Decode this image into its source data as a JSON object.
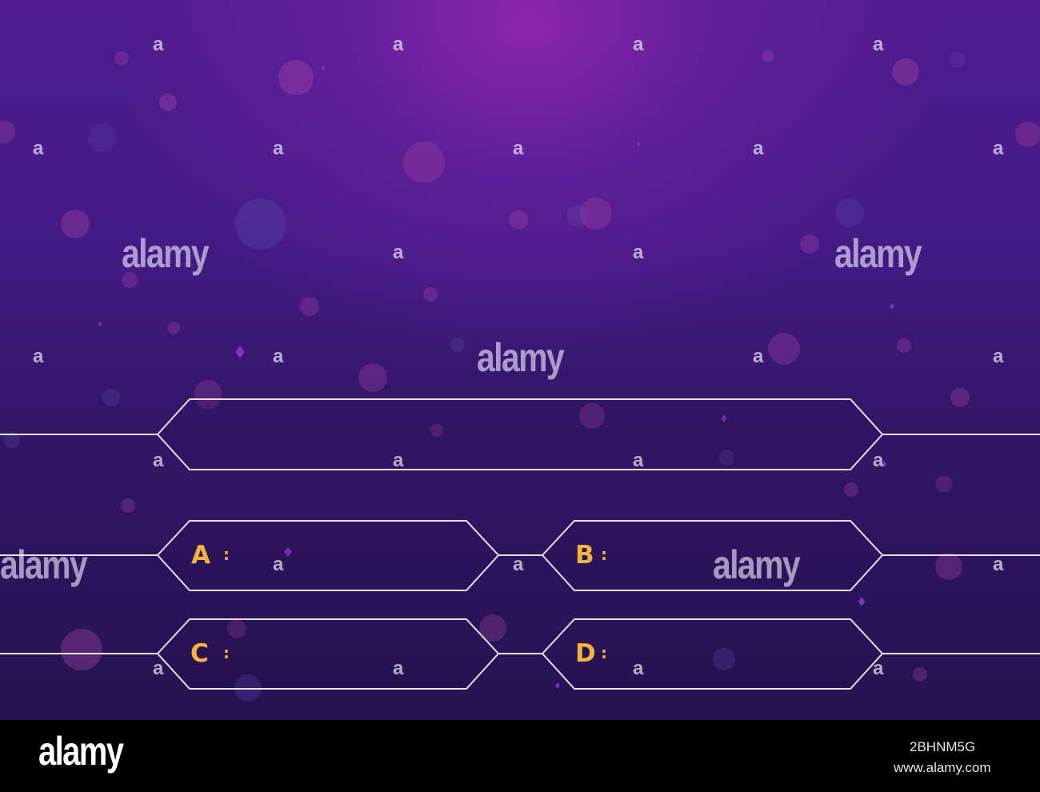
{
  "quiz": {
    "question": {
      "text": ""
    },
    "answers": [
      {
        "letter": "A",
        "sep": ":",
        "text": ""
      },
      {
        "letter": "B",
        "sep": ":",
        "text": ""
      },
      {
        "letter": "C",
        "sep": ":",
        "text": ""
      },
      {
        "letter": "D",
        "sep": ":",
        "text": ""
      }
    ]
  },
  "watermark": {
    "brand": "alamy",
    "mark": "a"
  },
  "footer": {
    "brand": "alamy",
    "image_code": "2BHNM5G",
    "site": "www.alamy.com"
  },
  "colors": {
    "frame_stroke": "#e6e0f2",
    "letter_color": "#f4b43c",
    "bg_top": "#7b239f",
    "bg_bottom": "#241350"
  }
}
